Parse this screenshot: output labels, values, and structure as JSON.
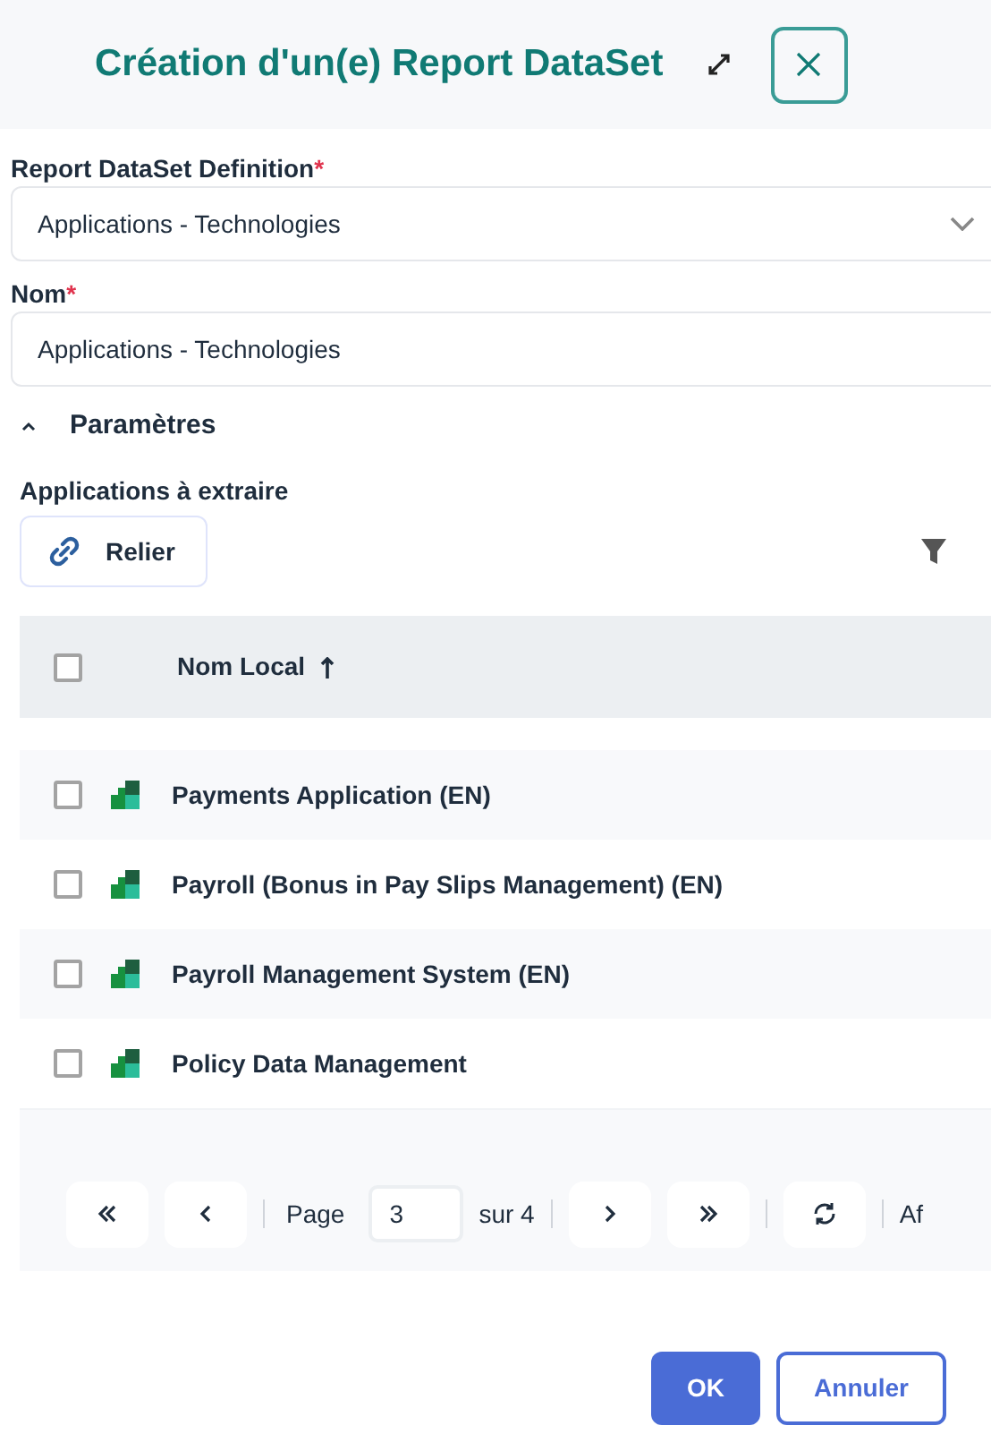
{
  "dialog": {
    "title": "Création d'un(e) Report DataSet"
  },
  "fields": [
    {
      "label": "Report DataSet Definition",
      "required_mark": "*",
      "kind": "select",
      "value": "Applications - Technologies"
    },
    {
      "label": "Nom",
      "required_mark": "*",
      "kind": "text",
      "value": "Applications - Technologies"
    }
  ],
  "section": {
    "title": "Paramètres",
    "expanded": true
  },
  "subsection": {
    "title": "Applications à extraire",
    "link_button": "Relier"
  },
  "table": {
    "header": {
      "label": "Nom Local",
      "checked": false
    },
    "rows": [
      {
        "name": "Payments Application (EN)",
        "checked": false
      },
      {
        "name": "Payroll (Bonus in Pay Slips Management) (EN)",
        "checked": false
      },
      {
        "name": "Payroll Management System (EN)",
        "checked": false
      },
      {
        "name": "Policy Data Management",
        "checked": false
      }
    ]
  },
  "pagination": {
    "page_label": "Page",
    "page": "3",
    "total": "sur 4",
    "trailing": "Af"
  },
  "buttons": {
    "ok": "OK",
    "cancel": "Annuler"
  }
}
